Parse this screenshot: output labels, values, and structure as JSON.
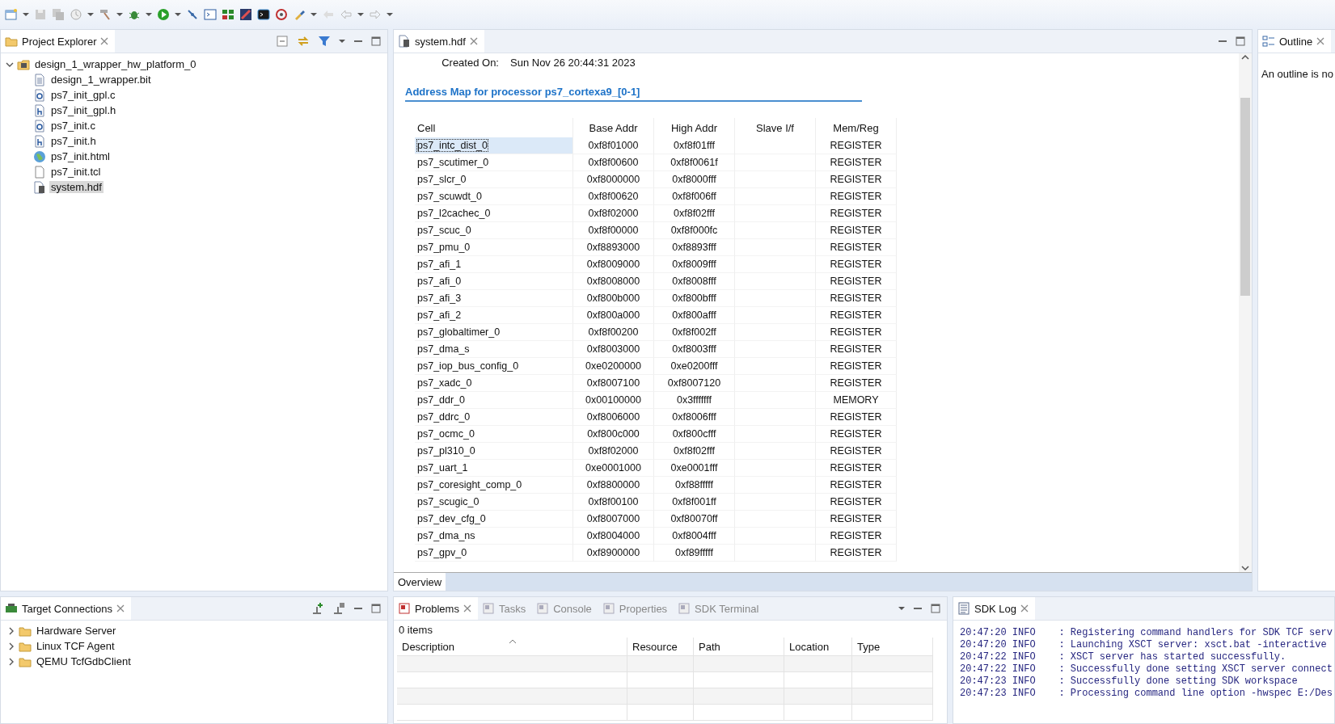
{
  "project_explorer": {
    "title": "Project Explorer",
    "tree": [
      {
        "label": "design_1_wrapper_hw_platform_0",
        "kind": "project",
        "expanded": true,
        "selected": false,
        "children": [
          {
            "label": "design_1_wrapper.bit",
            "kind": "text",
            "selected": false
          },
          {
            "label": "ps7_init_gpl.c",
            "kind": "c",
            "selected": false
          },
          {
            "label": "ps7_init_gpl.h",
            "kind": "h",
            "selected": false
          },
          {
            "label": "ps7_init.c",
            "kind": "c",
            "selected": false
          },
          {
            "label": "ps7_init.h",
            "kind": "h",
            "selected": false
          },
          {
            "label": "ps7_init.html",
            "kind": "html",
            "selected": false
          },
          {
            "label": "ps7_init.tcl",
            "kind": "blank",
            "selected": false
          },
          {
            "label": "system.hdf",
            "kind": "hdf",
            "selected": true
          }
        ]
      }
    ]
  },
  "editor": {
    "tab": "system.hdf",
    "created_on_label": "Created On:",
    "created_on": "Sun Nov 26 20:44:31 2023",
    "section_title": "Address Map for processor ps7_cortexa9_[0-1]",
    "columns": [
      "Cell",
      "Base Addr",
      "High Addr",
      "Slave I/f",
      "Mem/Reg"
    ],
    "rows": [
      {
        "cell": "ps7_intc_dist_0",
        "base": "0xf8f01000",
        "high": "0xf8f01fff",
        "type": "REGISTER",
        "selected": true
      },
      {
        "cell": "ps7_scutimer_0",
        "base": "0xf8f00600",
        "high": "0xf8f0061f",
        "type": "REGISTER",
        "selected": false
      },
      {
        "cell": "ps7_slcr_0",
        "base": "0xf8000000",
        "high": "0xf8000fff",
        "type": "REGISTER",
        "selected": false
      },
      {
        "cell": "ps7_scuwdt_0",
        "base": "0xf8f00620",
        "high": "0xf8f006ff",
        "type": "REGISTER",
        "selected": false
      },
      {
        "cell": "ps7_l2cachec_0",
        "base": "0xf8f02000",
        "high": "0xf8f02fff",
        "type": "REGISTER",
        "selected": false
      },
      {
        "cell": "ps7_scuc_0",
        "base": "0xf8f00000",
        "high": "0xf8f000fc",
        "type": "REGISTER",
        "selected": false
      },
      {
        "cell": "ps7_pmu_0",
        "base": "0xf8893000",
        "high": "0xf8893fff",
        "type": "REGISTER",
        "selected": false
      },
      {
        "cell": "ps7_afi_1",
        "base": "0xf8009000",
        "high": "0xf8009fff",
        "type": "REGISTER",
        "selected": false
      },
      {
        "cell": "ps7_afi_0",
        "base": "0xf8008000",
        "high": "0xf8008fff",
        "type": "REGISTER",
        "selected": false
      },
      {
        "cell": "ps7_afi_3",
        "base": "0xf800b000",
        "high": "0xf800bfff",
        "type": "REGISTER",
        "selected": false
      },
      {
        "cell": "ps7_afi_2",
        "base": "0xf800a000",
        "high": "0xf800afff",
        "type": "REGISTER",
        "selected": false
      },
      {
        "cell": "ps7_globaltimer_0",
        "base": "0xf8f00200",
        "high": "0xf8f002ff",
        "type": "REGISTER",
        "selected": false
      },
      {
        "cell": "ps7_dma_s",
        "base": "0xf8003000",
        "high": "0xf8003fff",
        "type": "REGISTER",
        "selected": false
      },
      {
        "cell": "ps7_iop_bus_config_0",
        "base": "0xe0200000",
        "high": "0xe0200fff",
        "type": "REGISTER",
        "selected": false
      },
      {
        "cell": "ps7_xadc_0",
        "base": "0xf8007100",
        "high": "0xf8007120",
        "type": "REGISTER",
        "selected": false
      },
      {
        "cell": "ps7_ddr_0",
        "base": "0x00100000",
        "high": "0x3fffffff",
        "type": "MEMORY",
        "selected": false
      },
      {
        "cell": "ps7_ddrc_0",
        "base": "0xf8006000",
        "high": "0xf8006fff",
        "type": "REGISTER",
        "selected": false
      },
      {
        "cell": "ps7_ocmc_0",
        "base": "0xf800c000",
        "high": "0xf800cfff",
        "type": "REGISTER",
        "selected": false
      },
      {
        "cell": "ps7_pl310_0",
        "base": "0xf8f02000",
        "high": "0xf8f02fff",
        "type": "REGISTER",
        "selected": false
      },
      {
        "cell": "ps7_uart_1",
        "base": "0xe0001000",
        "high": "0xe0001fff",
        "type": "REGISTER",
        "selected": false
      },
      {
        "cell": "ps7_coresight_comp_0",
        "base": "0xf8800000",
        "high": "0xf88fffff",
        "type": "REGISTER",
        "selected": false
      },
      {
        "cell": "ps7_scugic_0",
        "base": "0xf8f00100",
        "high": "0xf8f001ff",
        "type": "REGISTER",
        "selected": false
      },
      {
        "cell": "ps7_dev_cfg_0",
        "base": "0xf8007000",
        "high": "0xf80070ff",
        "type": "REGISTER",
        "selected": false
      },
      {
        "cell": "ps7_dma_ns",
        "base": "0xf8004000",
        "high": "0xf8004fff",
        "type": "REGISTER",
        "selected": false
      },
      {
        "cell": "ps7_gpv_0",
        "base": "0xf8900000",
        "high": "0xf89fffff",
        "type": "REGISTER",
        "selected": false
      }
    ],
    "bottom_tab": "Overview"
  },
  "outline": {
    "title": "Outline",
    "message": "An outline is no"
  },
  "target_connections": {
    "title": "Target Connections",
    "items": [
      {
        "label": "Hardware Server",
        "expanded": false
      },
      {
        "label": "Linux TCF Agent",
        "expanded": false
      },
      {
        "label": "QEMU TcfGdbClient",
        "expanded": false
      }
    ]
  },
  "problems": {
    "tabs": [
      {
        "label": "Problems",
        "selected": true
      },
      {
        "label": "Tasks",
        "selected": false
      },
      {
        "label": "Console",
        "selected": false
      },
      {
        "label": "Properties",
        "selected": false
      },
      {
        "label": "SDK Terminal",
        "selected": false
      }
    ],
    "count": "0 items",
    "columns": [
      "Description",
      "Resource",
      "Path",
      "Location",
      "Type"
    ]
  },
  "sdk_log": {
    "title": "SDK Log",
    "lines": [
      "20:47:20 INFO    : Registering command handlers for SDK TCF serv",
      "20:47:20 INFO    : Launching XSCT server: xsct.bat -interactive",
      "20:47:22 INFO    : XSCT server has started successfully.",
      "20:47:22 INFO    : Successfully done setting XSCT server connect",
      "20:47:23 INFO    : Successfully done setting SDK workspace",
      "20:47:23 INFO    : Processing command line option -hwspec E:/Des"
    ]
  }
}
